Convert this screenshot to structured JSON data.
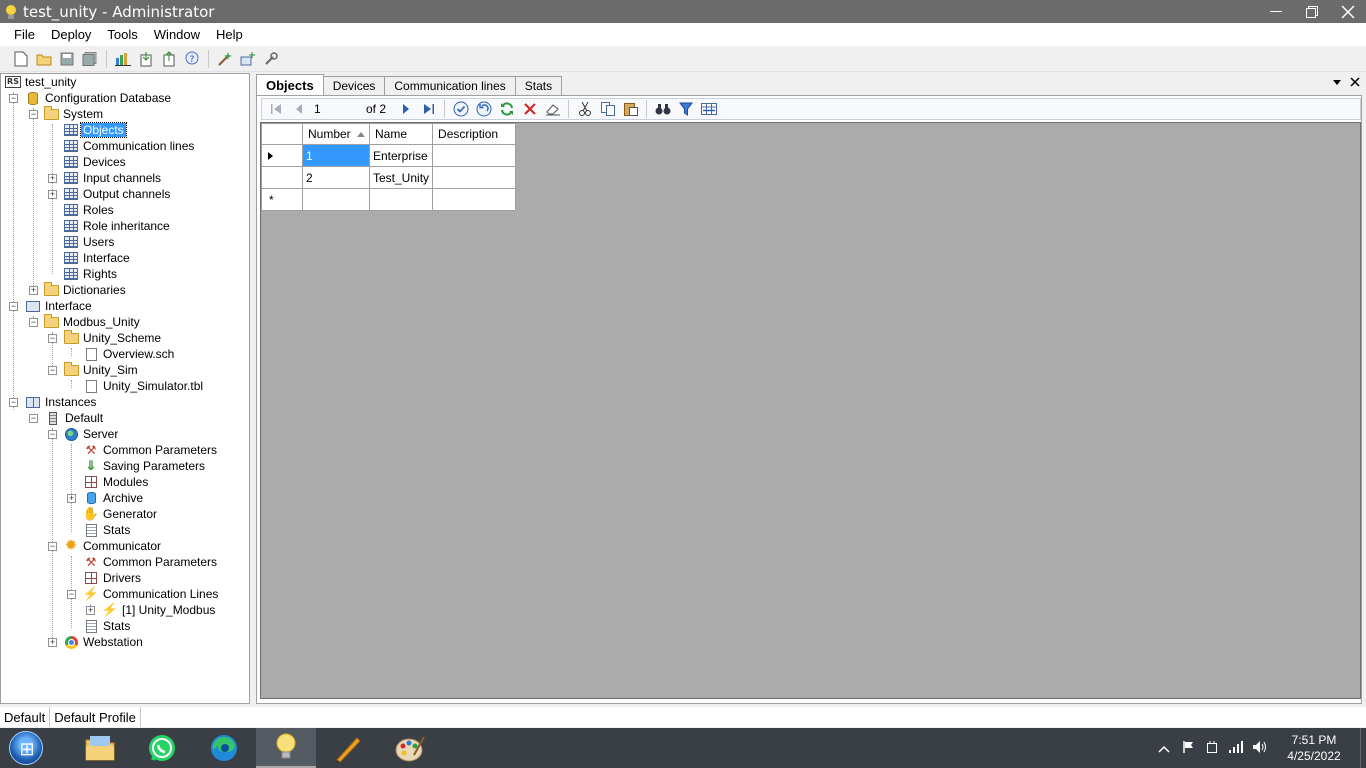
{
  "window": {
    "title": "test_unity - Administrator"
  },
  "menu": [
    "File",
    "Deploy",
    "Tools",
    "Window",
    "Help"
  ],
  "tree": {
    "root": "test_unity",
    "config_db": "Configuration Database",
    "system": "System",
    "system_items": [
      "Objects",
      "Communication lines",
      "Devices",
      "Input channels",
      "Output channels",
      "Roles",
      "Role inheritance",
      "Users",
      "Interface",
      "Rights"
    ],
    "dictionaries": "Dictionaries",
    "interface": "Interface",
    "modbus_unity": "Modbus_Unity",
    "unity_scheme": "Unity_Scheme",
    "overview": "Overview.sch",
    "unity_sim": "Unity_Sim",
    "unity_simulator": "Unity_Simulator.tbl",
    "instances": "Instances",
    "default": "Default",
    "server": "Server",
    "server_items": [
      "Common Parameters",
      "Saving Parameters",
      "Modules",
      "Archive",
      "Generator",
      "Stats"
    ],
    "communicator": "Communicator",
    "comm_items": [
      "Common Parameters",
      "Drivers",
      "Communication Lines"
    ],
    "comm_line": "[1] Unity_Modbus",
    "comm_stats": "Stats",
    "webstation": "Webstation"
  },
  "tabs": [
    "Objects",
    "Devices",
    "Communication lines",
    "Stats"
  ],
  "navigator": {
    "position": "1",
    "total": "of 2"
  },
  "grid": {
    "columns": [
      "Number",
      "Name",
      "Description"
    ],
    "rows": [
      {
        "number": "1",
        "name": "Enterprise",
        "description": ""
      },
      {
        "number": "2",
        "name": "Test_Unity",
        "description": ""
      }
    ],
    "new_row_marker": "*"
  },
  "status": {
    "instance": "Default",
    "profile": "Default Profile"
  },
  "taskbar": {
    "time": "7:51 PM",
    "date": "4/25/2022"
  },
  "colors": {
    "selection": "#3399ff",
    "titlebar": "#6b6b6b",
    "taskbar": "#3a3f45",
    "grid_background": "#ababab"
  }
}
